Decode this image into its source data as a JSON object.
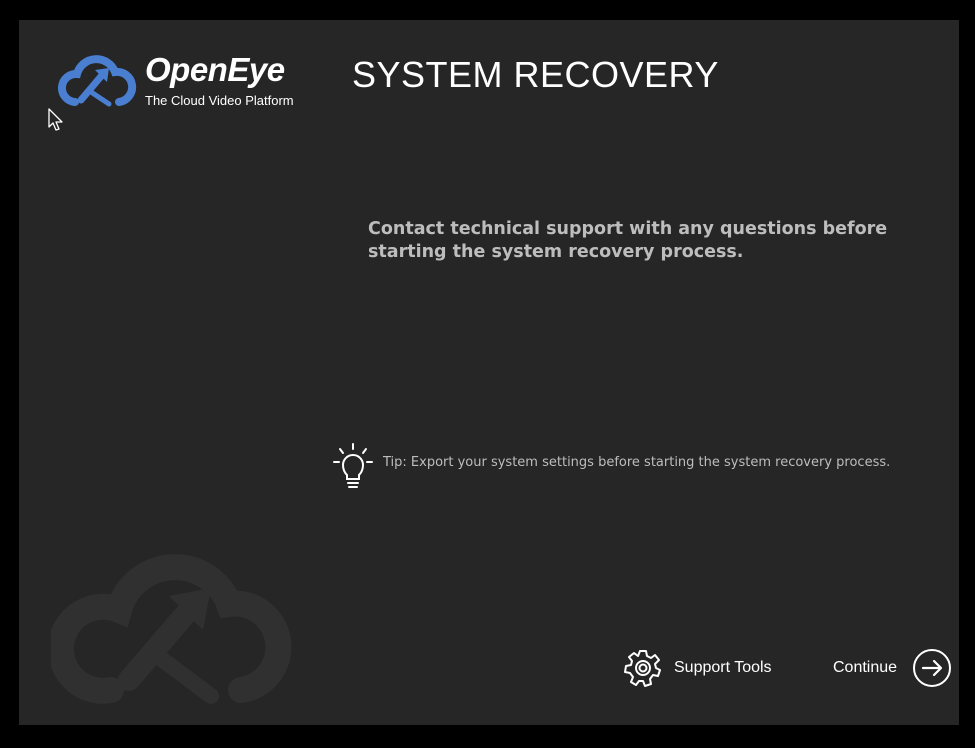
{
  "brand": {
    "name": "OpenEye",
    "tagline": "The Cloud Video Platform",
    "accent_color": "#4a7ed0"
  },
  "title": "SYSTEM RECOVERY",
  "message": "Contact technical support with any questions before starting the system recovery process.",
  "tip": {
    "icon": "lightbulb-icon",
    "text": "Tip: Export your system settings before starting the system recovery process."
  },
  "footer": {
    "support_tools": {
      "label": "Support Tools",
      "icon": "gear-icon"
    },
    "continue": {
      "label": "Continue",
      "icon": "arrow-right-circle-icon"
    }
  },
  "colors": {
    "background": "#262626",
    "frame": "#000000",
    "text_primary": "#ffffff",
    "text_secondary": "#bdbdbd"
  }
}
